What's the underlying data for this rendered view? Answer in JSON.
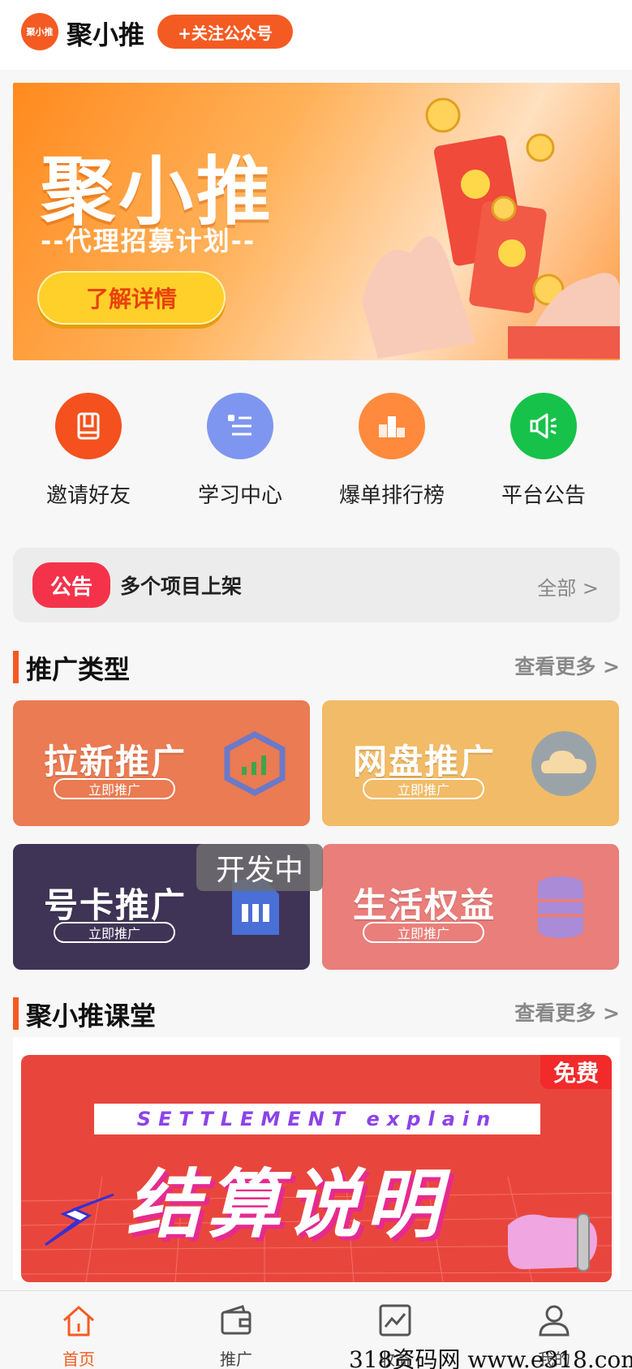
{
  "header": {
    "logo_text": "聚小推",
    "app_title": "聚小推",
    "follow_label": "+关注公众号"
  },
  "banner": {
    "title": "聚小推",
    "subtitle": "--代理招募计划--",
    "button_label": "了解详情"
  },
  "quick_nav": [
    {
      "label": "邀请好友",
      "icon": "book-icon",
      "color": "#f4511e"
    },
    {
      "label": "学习中心",
      "icon": "list-icon",
      "color": "#7f96f0"
    },
    {
      "label": "爆单排行榜",
      "icon": "ranking-icon",
      "color": "#ff8a3d"
    },
    {
      "label": "平台公告",
      "icon": "speaker-icon",
      "color": "#17c24a"
    }
  ],
  "notice": {
    "badge": "公告",
    "text": "多个项目上架",
    "all_label": "全部 >"
  },
  "promo_section": {
    "title": "推广类型",
    "more_label": "查看更多 >"
  },
  "promo_cards": [
    {
      "title": "拉新推广",
      "button": "立即推广",
      "color": "#ea7b52",
      "icon": "hexagon-chart-icon"
    },
    {
      "title": "网盘推广",
      "button": "立即推广",
      "color": "#f2bb67",
      "icon": "cloud-icon"
    },
    {
      "title": "号卡推广",
      "button": "立即推广",
      "color": "#3f3456",
      "icon": "sim-card-icon"
    },
    {
      "title": "生活权益",
      "button": "立即推广",
      "color": "#e97e7a",
      "icon": "database-icon"
    }
  ],
  "dev_tag": "开发中",
  "course_section": {
    "title": "聚小推课堂",
    "more_label": "查看更多 >"
  },
  "course_card": {
    "free_badge": "免费",
    "english_title": "SETTLEMENT explain",
    "chinese_title": "结算说明"
  },
  "tabbar": [
    {
      "label": "首页",
      "icon": "home-icon",
      "active": true
    },
    {
      "label": "推广",
      "icon": "wallet-icon",
      "active": false
    },
    {
      "label": "收益",
      "icon": "chart-icon",
      "active": false
    },
    {
      "label": "我的",
      "icon": "user-icon",
      "active": false
    }
  ],
  "watermark": "318资码网 www.e318.com"
}
